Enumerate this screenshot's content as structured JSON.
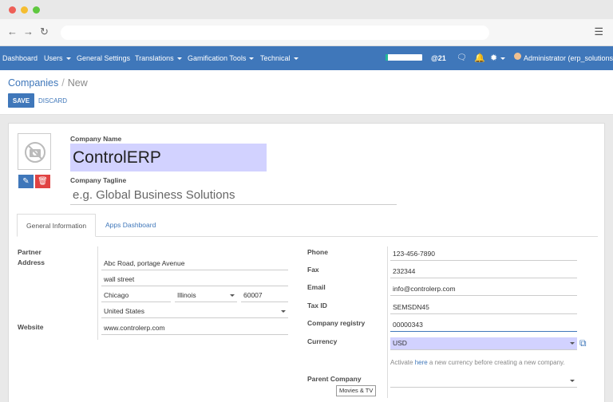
{
  "browser": {
    "window_dots": [
      "#ee5f57",
      "#f5bd30",
      "#5fc83f"
    ],
    "icons": [
      "back-arrow-icon",
      "forward-arrow-icon",
      "reload-icon",
      "menu-icon"
    ]
  },
  "navbar": {
    "items": [
      "Dashboard",
      "Users",
      "General Settings",
      "Translations",
      "Gamification Tools",
      "Technical"
    ],
    "progress_fraction": 0.06,
    "mentions_count": "@21",
    "user_label": "Administrator (erp_solutions)",
    "colors": {
      "bar": "#3f77ba",
      "progress": "#21b799"
    }
  },
  "control_panel": {
    "breadcrumb_parent": "Companies",
    "breadcrumb_separator": "/",
    "breadcrumb_current": "New",
    "save_label": "SAVE",
    "discard_label": "DISCARD"
  },
  "form": {
    "company_name_label": "Company Name",
    "company_name_value": "ControlERP",
    "tagline_label": "Company Tagline",
    "tagline_placeholder": "e.g. Global Business Solutions",
    "tabs": [
      "General Information",
      "Apps Dashboard"
    ],
    "partner_label": "Partner",
    "address_label": "Address",
    "address": {
      "street": "Abc Road, portage Avenue",
      "street2": "wall street",
      "city": "Chicago",
      "state": "Illinois",
      "zip": "60007",
      "country": "United States"
    },
    "website_label": "Website",
    "website_value": "www.controlerp.com",
    "phone_label": "Phone",
    "phone_value": "123-456-7890",
    "fax_label": "Fax",
    "fax_value": "232344",
    "email_label": "Email",
    "email_value": "info@controlerp.com",
    "taxid_label": "Tax ID",
    "taxid_value": "SEMSDN45",
    "registry_label": "Company registry",
    "registry_value": "00000343",
    "currency_label": "Currency",
    "currency_value": "USD",
    "currency_note_pre": "Activate ",
    "currency_note_link": "here",
    "currency_note_post": " a new currency before creating a new company.",
    "parent_label": "Parent Company",
    "tooltip": "Movies & TV",
    "highlight_color": "#d2d2ff"
  }
}
